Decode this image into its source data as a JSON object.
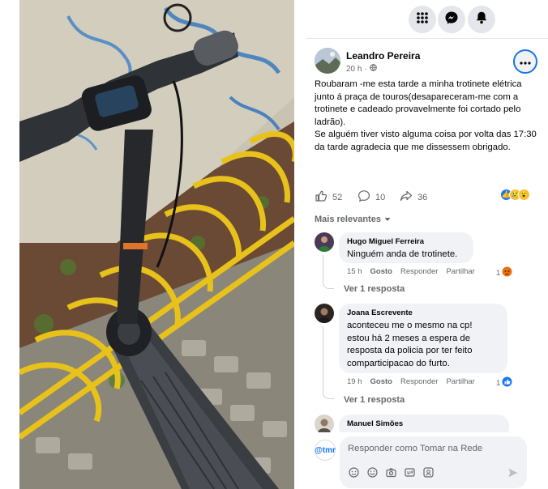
{
  "post": {
    "author": "Leandro Pereira",
    "time": "20 h",
    "body": "Roubaram -me esta tarde a minha trotinete elétrica junto á praça de touros(desapareceram-me com a trotinete e cadeado provavelmente foi cortado pelo ladrão).\nSe alguém tiver visto alguma coisa por volta das 17:30 da tarde agradecia que me dissessem obrigado.",
    "likes": "52",
    "comments": "10",
    "shares": "36"
  },
  "sort_label": "Mais relevantes",
  "comments": [
    {
      "name": "Hugo Miguel Ferreira",
      "text": "Ninguém anda de trotinete.",
      "time": "15 h",
      "like": "Gosto",
      "reply": "Responder",
      "share": "Partilhar",
      "reaction_count": "1",
      "view_replies": "Ver 1 resposta"
    },
    {
      "name": "Joana Escrevente",
      "text": "aconteceu me o mesmo na cp!\nestou há 2 meses a espera de\nresposta da policia por ter feito\ncomparticipacao do furto.",
      "time": "19 h",
      "like": "Gosto",
      "reply": "Responder",
      "share": "Partilhar",
      "reaction_count": "1",
      "view_replies": "Ver 1 resposta"
    },
    {
      "name": "Manuel Simões"
    }
  ],
  "composer": {
    "avatar_text": "@tmr",
    "placeholder": "Responder como Tomar na Rede"
  },
  "icons": {
    "top": [
      "grid-menu-icon",
      "messenger-icon",
      "bell-icon"
    ],
    "composer_tools": [
      "sticker-icon",
      "emoji-icon",
      "camera-icon",
      "gif-icon",
      "avatar-sticker-icon"
    ]
  },
  "colors": {
    "accent": "#1877f2",
    "bubble": "#f0f2f5",
    "muted": "#65676b",
    "rack_yellow": "#e8c21a"
  }
}
